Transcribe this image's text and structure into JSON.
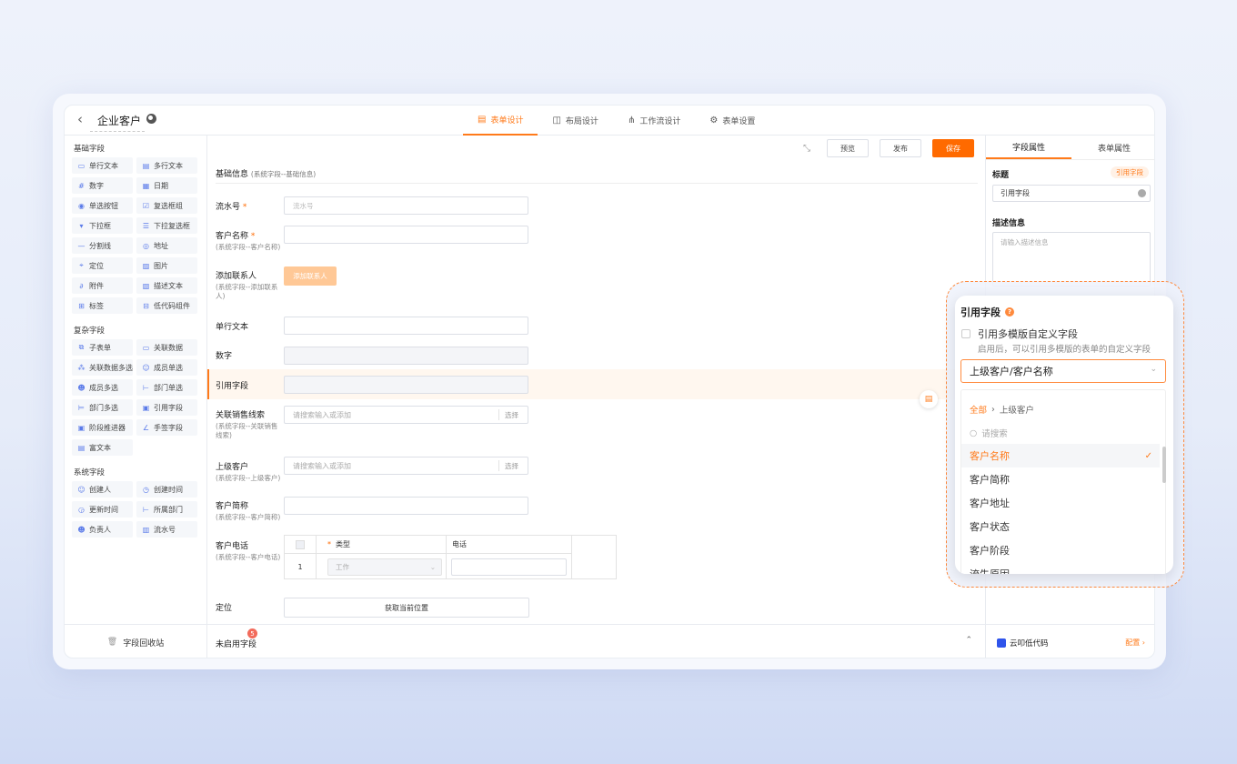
{
  "header": {
    "back_icon": "chevron-left-icon",
    "title": "企业客户",
    "tabs": [
      {
        "label": "表单设计",
        "icon": "form-icon",
        "active": true
      },
      {
        "label": "布局设计",
        "icon": "layout-icon",
        "active": false
      },
      {
        "label": "工作流设计",
        "icon": "workflow-icon",
        "active": false
      },
      {
        "label": "表单设置",
        "icon": "gear-icon",
        "active": false
      }
    ]
  },
  "left_panel": {
    "basic_title": "基础字段",
    "basic_fields": [
      "单行文本",
      "多行文本",
      "数字",
      "日期",
      "单选按钮",
      "复选框组",
      "下拉框",
      "下拉复选框",
      "分割线",
      "地址",
      "定位",
      "图片",
      "附件",
      "描述文本",
      "标签",
      "低代码组件"
    ],
    "complex_title": "复杂字段",
    "complex_fields": [
      "子表单",
      "关联数据",
      "关联数据多选",
      "成员单选",
      "成员多选",
      "部门单选",
      "部门多选",
      "引用字段",
      "阶段推进器",
      "手签字段",
      "富文本"
    ],
    "system_title": "系统字段",
    "system_fields": [
      "创建人",
      "创建时间",
      "更新时间",
      "所属部门",
      "负责人",
      "流水号"
    ],
    "recycle_label": "字段回收站"
  },
  "toolbar": {
    "preview": "预览",
    "publish": "发布",
    "save": "保存"
  },
  "form": {
    "group_title": "基础信息",
    "group_sub": "(系统字段--基础信息)",
    "serial_label": "流水号",
    "serial_placeholder": "流水号",
    "customer_name_label": "客户名称",
    "customer_name_sub": "(系统字段--客户名称)",
    "add_contact_label": "添加联系人",
    "add_contact_sub": "(系统字段--添加联系人)",
    "add_contact_btn": "添加联系人",
    "single_text_label": "单行文本",
    "number_label": "数字",
    "ref_field_label": "引用字段",
    "sales_lead_label": "关联销售线索",
    "sales_lead_sub": "(系统字段--关联销售线索)",
    "search_placeholder": "请搜索输入或添加",
    "select_btn": "选择",
    "parent_customer_label": "上级客户",
    "parent_customer_sub": "(系统字段--上级客户)",
    "short_name_label": "客户简称",
    "short_name_sub": "(系统字段--客户简称)",
    "phone_label": "客户电话",
    "phone_sub": "(系统字段--客户电话)",
    "phone_table": {
      "col_type": "类型",
      "col_phone": "电话",
      "row_index": "1",
      "type_value": "工作"
    },
    "location_label": "定位",
    "location_btn": "获取当前位置"
  },
  "bottom_bar": {
    "unused_label": "未启用字段",
    "unused_count": "5"
  },
  "right_panel": {
    "tab_field": "字段属性",
    "tab_form": "表单属性",
    "title_label": "标题",
    "title_tag": "引用字段",
    "title_value": "引用字段",
    "desc_label": "描述信息",
    "desc_placeholder": "请输入描述信息",
    "footer_brand": "云叩低代码",
    "footer_config": "配置"
  },
  "popup": {
    "title": "引用字段",
    "multi_label": "引用多模版自定义字段",
    "multi_hint": "启用后，可以引用多模版的表单的自定义字段",
    "selected_value": "上级客户/客户名称",
    "breadcrumb_all": "全部",
    "breadcrumb_current": "上级客户",
    "search_placeholder": "请搜索",
    "options": [
      "客户名称",
      "客户简称",
      "客户地址",
      "客户状态",
      "客户阶段",
      "流失原因"
    ],
    "accent_color": "#ff7a1a"
  }
}
